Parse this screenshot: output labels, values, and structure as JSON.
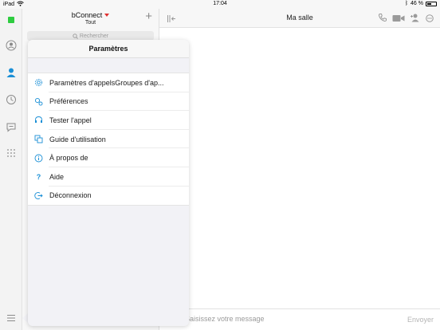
{
  "status_bar": {
    "device": "iPad",
    "time": "17:04",
    "battery": "46 %"
  },
  "rail": {
    "items": [
      {
        "icon": "presence-icon",
        "color": "#2ecc40"
      },
      {
        "icon": "profile-card-icon"
      },
      {
        "icon": "contacts-icon",
        "active": true
      },
      {
        "icon": "history-icon"
      },
      {
        "icon": "chat-icon"
      },
      {
        "icon": "dialpad-icon"
      },
      {
        "icon": "hamburger-menu-icon"
      }
    ]
  },
  "list_pane": {
    "title": "bConnect",
    "subtitle": "Tout",
    "add_icon": "plus-icon",
    "search_placeholder": "Rechercher"
  },
  "chat": {
    "title": "Ma salle",
    "header_icons": [
      "sidebar-toggle-icon",
      "phone-icon",
      "video-icon",
      "add-person-icon",
      "more-icon"
    ],
    "composer_placeholder": "Saisissez votre message",
    "send_label": "Envoyer"
  },
  "settings": {
    "title": "Paramètres",
    "items": [
      {
        "label": "Paramètres d'appelsGroupes d'ap...",
        "icon": "gear-icon"
      },
      {
        "label": "Préférences",
        "icon": "preferences-gear-icon"
      },
      {
        "label": "Tester l'appel",
        "icon": "headset-icon"
      },
      {
        "label": "Guide d'utilisation",
        "icon": "copy-guide-icon"
      },
      {
        "label": "À propos de",
        "icon": "info-icon"
      },
      {
        "label": "Aide",
        "icon": "question-icon"
      },
      {
        "label": "Déconnexion",
        "icon": "logout-icon"
      }
    ]
  },
  "colors": {
    "accent": "#1a8fd6",
    "presence": "#2ecc40",
    "caret": "#e03030"
  }
}
